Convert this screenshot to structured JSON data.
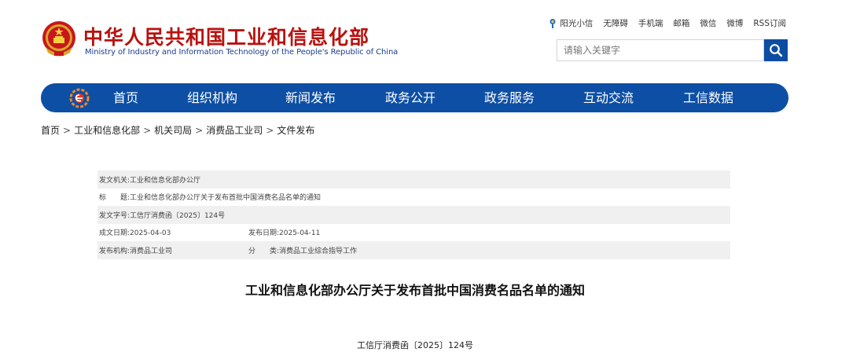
{
  "header": {
    "title": "中华人民共和国工业和信息化部",
    "subtitle": "Ministry of Industry and Information Technology of the People's Republic of China",
    "emblem_icon": "national-emblem-icon",
    "colors": {
      "title": "#b8120f",
      "subtitle": "#1a3e8e"
    }
  },
  "toplinks": {
    "sun_icon": "sun-icon",
    "items": [
      "阳光小信",
      "无障碍",
      "手机端",
      "邮箱",
      "微信",
      "微博",
      "RSS订阅"
    ]
  },
  "search": {
    "placeholder": "请输入关键字",
    "value": "",
    "icon": "search-icon"
  },
  "nav": {
    "color": "#0d4fa5",
    "logo_icon": "e-gov-logo-icon",
    "items": [
      "首页",
      "组织机构",
      "新闻发布",
      "政务公开",
      "政务服务",
      "互动交流",
      "工信数据"
    ]
  },
  "breadcrumb": {
    "items": [
      "首页",
      "工业和信息化部",
      "机关司局",
      "消费品工业司",
      "文件发布"
    ],
    "separator": ">"
  },
  "info": {
    "issuer_label": "发文机关:",
    "issuer_value": "工业和信息化部办公厅",
    "title_label": "标　　题:",
    "title_value": "工业和信息化部办公厅关于发布首批中国消费名品名单的通知",
    "docno_label": "发文字号:",
    "docno_value": "工信厅消费函〔2025〕124号",
    "created_label": "成文日期:",
    "created_value": "2025-04-03",
    "published_label": "发布日期:",
    "published_value": "2025-04-11",
    "org_label": "发布机构:",
    "org_value": "消费品工业司",
    "category_label": "分　　类:",
    "category_value": "消费品工业综合指导工作"
  },
  "document": {
    "title": "工业和信息化部办公厅关于发布首批中国消费名品名单的通知",
    "number": "工信厅消费函〔2025〕124号"
  }
}
